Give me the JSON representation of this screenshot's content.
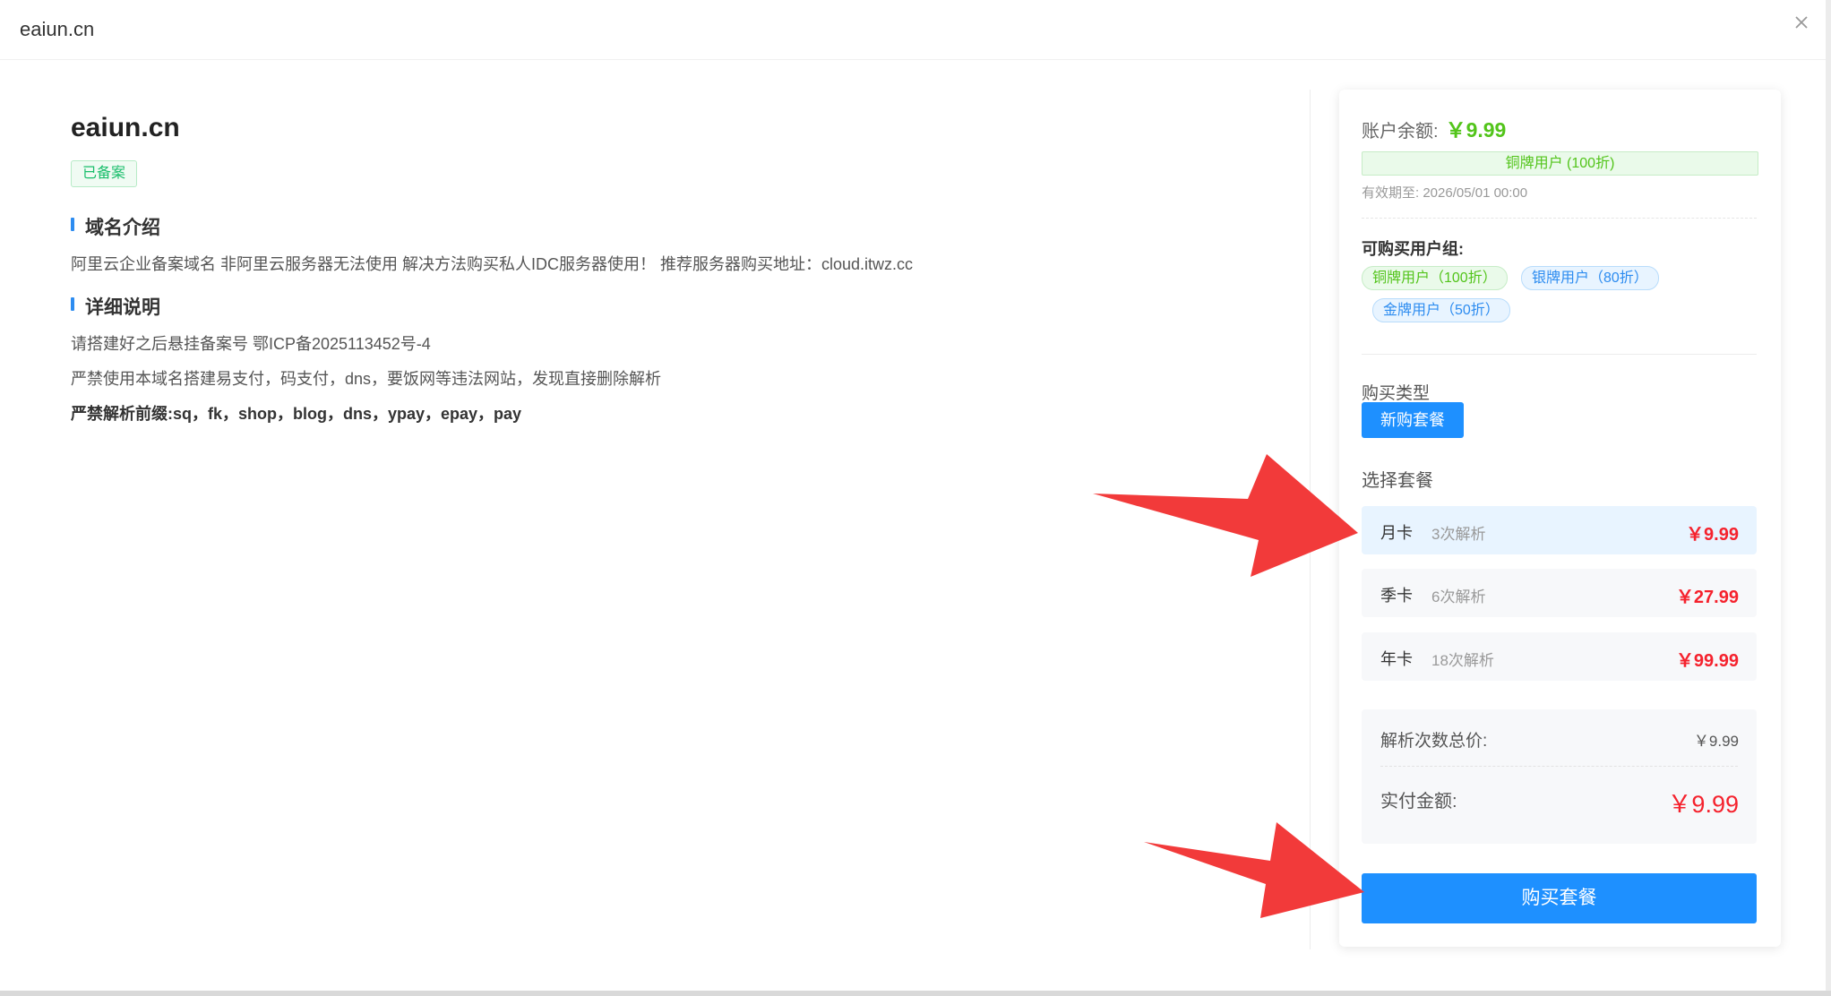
{
  "window": {
    "title": "eaiun.cn"
  },
  "domain": {
    "name": "eaiun.cn",
    "badge": "已备案",
    "intro_heading": "域名介绍",
    "intro_text": "阿里云企业备案域名 非阿里云服务器无法使用 解决方法购买私人IDC服务器使用！ 推荐服务器购买地址：cloud.itwz.cc",
    "detail_heading": "详细说明",
    "detail_lines": [
      "请搭建好之后悬挂备案号 鄂ICP备2025113452号-4",
      "严禁使用本域名搭建易支付，码支付，dns，要饭网等违法网站，发现直接删除解析",
      "严禁解析前缀:sq，fk，shop，blog，dns，ypay，epay，pay"
    ]
  },
  "account": {
    "balance_label": "账户余额:",
    "balance_value": "￥9.99",
    "tier": "铜牌用户 (100折)",
    "expire": "有效期至: 2026/05/01 00:00"
  },
  "groups": {
    "title": "可购买用户组:",
    "items": [
      "铜牌用户（100折）",
      "银牌用户（80折）",
      "金牌用户（50折）"
    ]
  },
  "purchase": {
    "type_label": "购买类型",
    "type_button": "新购套餐",
    "plan_label": "选择套餐",
    "plans": [
      {
        "name": "月卡",
        "desc": "3次解析",
        "price": "￥9.99"
      },
      {
        "name": "季卡",
        "desc": "6次解析",
        "price": "￥27.99"
      },
      {
        "name": "年卡",
        "desc": "18次解析",
        "price": "￥99.99"
      }
    ],
    "selected_plan": "月卡",
    "total_label": "解析次数总价:",
    "total_value": "￥9.99",
    "pay_label": "实付金额:",
    "pay_value": "￥9.99",
    "buy_button": "购买套餐"
  },
  "icons": {
    "close": "close-icon",
    "arrow": "red-arrow-icon"
  },
  "colors": {
    "accent": "#1e90ff",
    "price": "#f5222d",
    "green": "#52c41a",
    "arrow": "#f23a3a"
  }
}
